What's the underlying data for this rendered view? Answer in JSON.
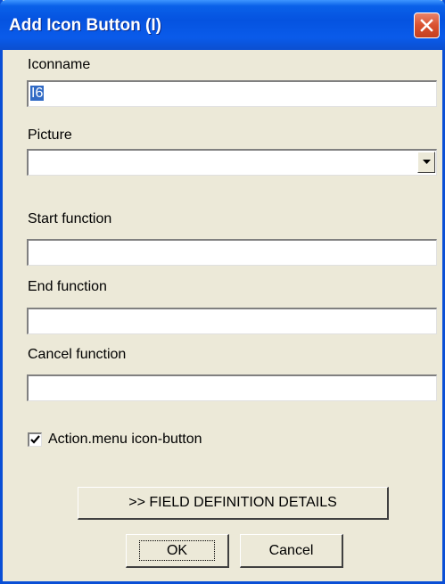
{
  "window": {
    "title": "Add Icon Button (I)",
    "close_icon": "close-icon",
    "title_color": "#0A61E9",
    "background": "#ECE9D8"
  },
  "form": {
    "iconname_label": "Iconname",
    "iconname_value": "I6",
    "picture_label": "Picture",
    "picture_value": "",
    "start_function_label": "Start function",
    "start_function_value": "",
    "end_function_label": "End function",
    "end_function_value": "",
    "cancel_function_label": "Cancel function",
    "cancel_function_value": "",
    "action_menu_label": "Action.menu icon-button",
    "action_menu_checked": true
  },
  "buttons": {
    "details_label": ">> FIELD DEFINITION DETAILS",
    "ok_label": "OK",
    "cancel_label": "Cancel"
  }
}
